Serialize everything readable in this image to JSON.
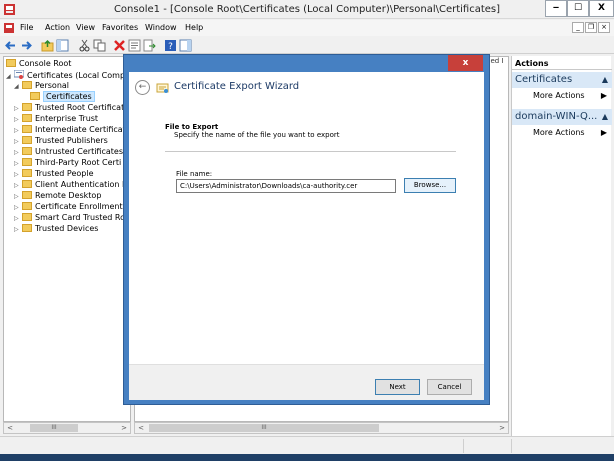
{
  "window": {
    "title": "Console1 - [Console Root\\Certificates (Local Computer)\\Personal\\Certificates]",
    "min_glyph": "‒",
    "max_glyph": "☐",
    "close_glyph": "X"
  },
  "menu": {
    "items": [
      "File",
      "Action",
      "View",
      "Favorites",
      "Window",
      "Help"
    ],
    "mdi_min": "_",
    "mdi_restore": "❐",
    "mdi_close": "×"
  },
  "toolbar": {
    "icons": [
      "back-arrow-icon",
      "forward-arrow-icon",
      "up-folder-icon",
      "show-hide-tree-icon",
      "cut-icon",
      "copy-icon",
      "delete-icon",
      "properties-icon",
      "export-list-icon",
      "help-icon",
      "show-action-pane-icon"
    ]
  },
  "tree": {
    "items": [
      {
        "label": "Console Root",
        "level": 0,
        "expander": "",
        "selected": false
      },
      {
        "label": "Certificates (Local Compu",
        "level": 1,
        "expander": "◢",
        "selected": false
      },
      {
        "label": "Personal",
        "level": 2,
        "expander": "◢",
        "selected": false
      },
      {
        "label": "Certificates",
        "level": 3,
        "expander": "",
        "selected": true
      },
      {
        "label": "Trusted Root Certificat",
        "level": 2,
        "expander": "▷",
        "selected": false
      },
      {
        "label": "Enterprise Trust",
        "level": 2,
        "expander": "▷",
        "selected": false
      },
      {
        "label": "Intermediate Certificat",
        "level": 2,
        "expander": "▷",
        "selected": false
      },
      {
        "label": "Trusted Publishers",
        "level": 2,
        "expander": "▷",
        "selected": false
      },
      {
        "label": "Untrusted Certificates",
        "level": 2,
        "expander": "▷",
        "selected": false
      },
      {
        "label": "Third-Party Root Certi",
        "level": 2,
        "expander": "▷",
        "selected": false
      },
      {
        "label": "Trusted People",
        "level": 2,
        "expander": "▷",
        "selected": false
      },
      {
        "label": "Client Authentication I",
        "level": 2,
        "expander": "▷",
        "selected": false
      },
      {
        "label": "Remote Desktop",
        "level": 2,
        "expander": "▷",
        "selected": false
      },
      {
        "label": "Certificate Enrollment",
        "level": 2,
        "expander": "▷",
        "selected": false
      },
      {
        "label": "Smart Card Trusted Ro",
        "level": 2,
        "expander": "▷",
        "selected": false
      },
      {
        "label": "Trusted Devices",
        "level": 2,
        "expander": "▷",
        "selected": false
      }
    ]
  },
  "center": {
    "column_fragment": "ded I"
  },
  "scroll": {
    "left_arrow": "<",
    "right_arrow": ">",
    "thumb_grip": "III"
  },
  "actions": {
    "header": "Actions",
    "sections": [
      {
        "title": "Certificates",
        "item": "More Actions"
      },
      {
        "title": "domain-WIN-Q...",
        "item": "More Actions"
      }
    ],
    "collapse_glyph": "▲",
    "item_arrow": "▶"
  },
  "wizard": {
    "close_glyph": "x",
    "back_glyph": "←",
    "title": "Certificate Export Wizard",
    "step_title": "File to Export",
    "step_desc": "Specify the name of the file you want to export",
    "file_label": "File name:",
    "file_value": "C:\\Users\\Administrator\\Downloads\\ca-authority.cer",
    "browse_label": "Browse...",
    "next_label": "Next",
    "cancel_label": "Cancel"
  },
  "colors": {
    "dialog_frame": "#4680c2",
    "close_red": "#c7403a",
    "actions_section": "#d9e8f7",
    "selection": "#cde8ff"
  }
}
